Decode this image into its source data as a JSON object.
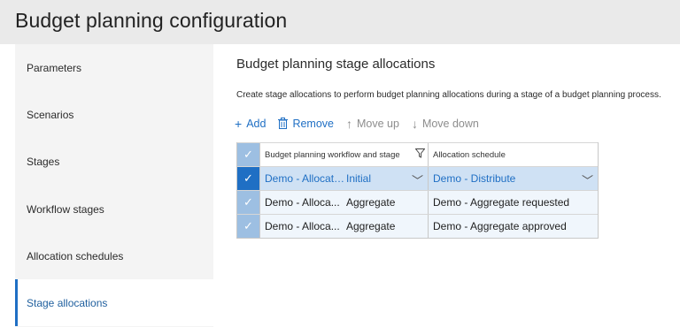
{
  "page": {
    "title": "Budget planning configuration"
  },
  "sidebar": {
    "items": [
      {
        "label": "Parameters",
        "active": false
      },
      {
        "label": "Scenarios",
        "active": false
      },
      {
        "label": "Stages",
        "active": false
      },
      {
        "label": "Workflow stages",
        "active": false
      },
      {
        "label": "Allocation schedules",
        "active": false
      },
      {
        "label": "Stage allocations",
        "active": true
      }
    ]
  },
  "main": {
    "title": "Budget planning stage allocations",
    "description": "Create stage allocations to perform budget planning allocations during a stage of a budget planning process.",
    "toolbar": {
      "add": {
        "label": "Add",
        "icon": "plus-icon"
      },
      "remove": {
        "label": "Remove",
        "icon": "trash-icon"
      },
      "move_up": {
        "label": "Move up",
        "icon": "arrow-up-icon"
      },
      "move_down": {
        "label": "Move down",
        "icon": "arrow-down-icon"
      }
    },
    "grid": {
      "columns": [
        "Budget planning workflow and stage",
        "Allocation schedule"
      ],
      "rows": [
        {
          "workflow": "Demo - Allocation",
          "stage": "Initial",
          "schedule": "Demo - Distribute",
          "selected": true
        },
        {
          "workflow": "Demo - Alloca...",
          "stage": "Aggregate",
          "schedule": "Demo - Aggregate requested",
          "selected": false
        },
        {
          "workflow": "Demo - Alloca...",
          "stage": "Aggregate",
          "schedule": "Demo - Aggregate approved",
          "selected": false
        }
      ]
    }
  },
  "colors": {
    "accent": "#1f6fc4",
    "selected_row": "#cfe1f4",
    "check_column": "#9dbfe2"
  }
}
